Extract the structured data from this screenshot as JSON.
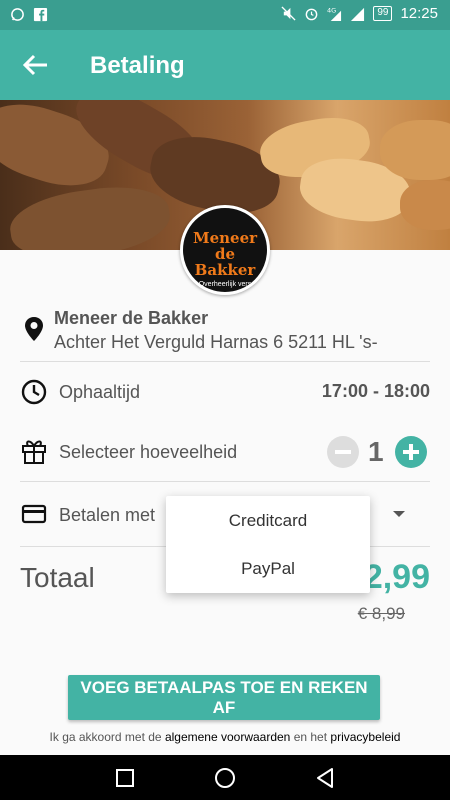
{
  "status_bar": {
    "left_icons": [
      "whatsapp-icon",
      "facebook-icon"
    ],
    "right_icons": [
      "mute-icon",
      "alarm-icon",
      "signal-4g-icon",
      "signal-icon"
    ],
    "battery": "99",
    "time": "12:25"
  },
  "app_bar": {
    "title": "Betaling",
    "back_icon": "arrow-left-icon"
  },
  "logo": {
    "name": "Meneer de Bakker",
    "name_line1": "Meneer",
    "name_line2": "de Bakker",
    "tagline": "Overheerlijk vers"
  },
  "store": {
    "name": "Meneer de Bakker",
    "address": "Achter Het Verguld Harnas 6 5211 HL 's-",
    "icon": "location-pin-icon"
  },
  "pickup": {
    "label": "Ophaaltijd",
    "time": "17:00 - 18:00",
    "icon": "clock-icon"
  },
  "quantity": {
    "label": "Selecteer hoeveelheid",
    "value": "1",
    "icon": "gift-icon"
  },
  "payment": {
    "label": "Betalen met",
    "icon": "credit-card-icon",
    "options": [
      "Creditcard",
      "PayPal"
    ]
  },
  "total": {
    "label": "Totaal",
    "price_visible": "2,99",
    "old_price": "€ 8,99"
  },
  "cta": {
    "label": "VOEG BETAALPAS TOE EN REKEN AF"
  },
  "terms": {
    "prefix": "Ik ga akkoord met de",
    "terms_link": "algemene voorwaarden",
    "middle": "en het",
    "privacy_link": "privacybeleid"
  },
  "colors": {
    "primary": "#43b3a4",
    "status_bar": "#3a9e90",
    "logo_orange": "#f07a1a"
  }
}
